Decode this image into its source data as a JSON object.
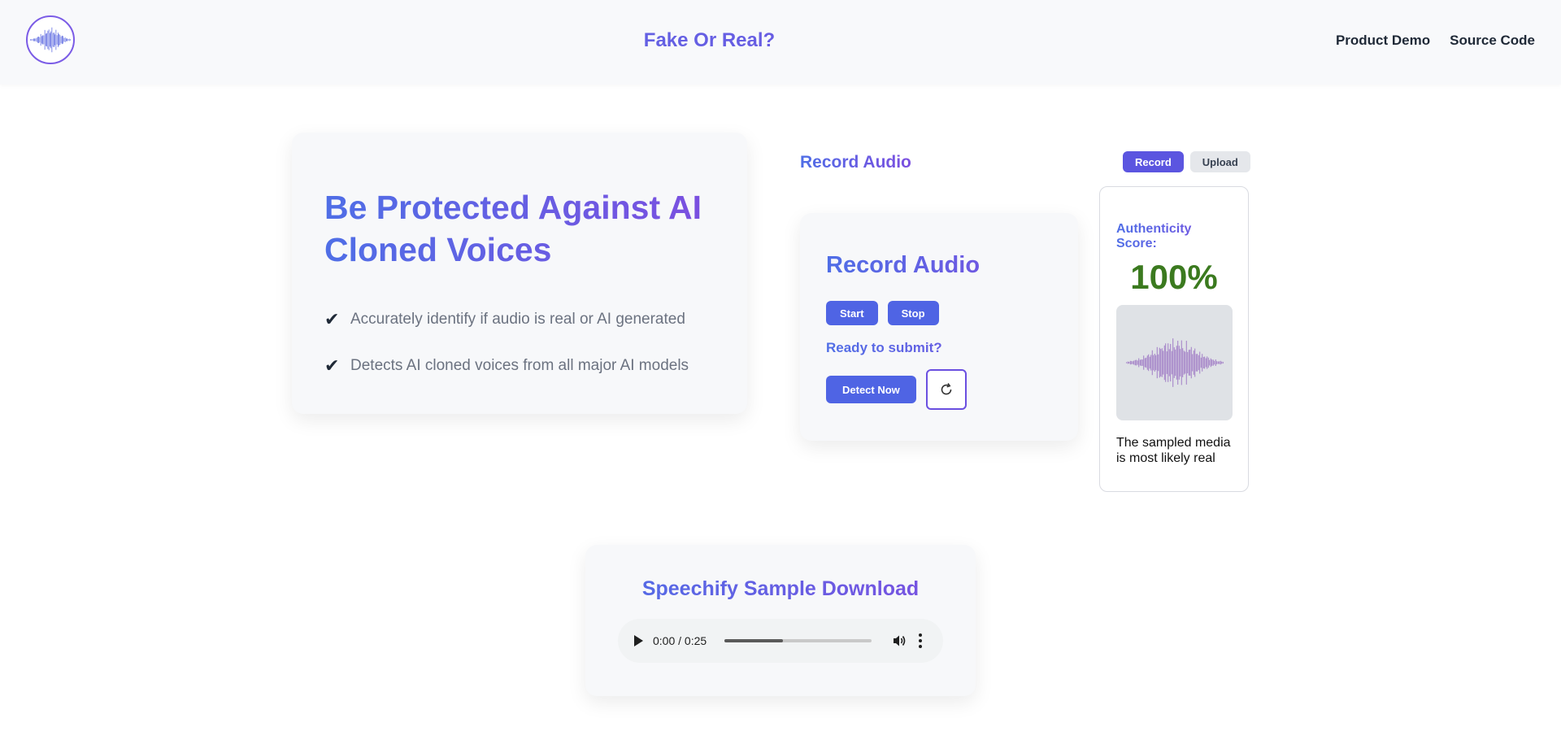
{
  "header": {
    "title": "Fake Or Real?",
    "nav": [
      "Product Demo",
      "Source Code"
    ]
  },
  "hero": {
    "heading": "Be Protected Against AI Cloned Voices",
    "features": [
      "Accurately identify if audio is real or AI generated",
      "Detects AI cloned voices from all major AI models"
    ]
  },
  "record_section": {
    "title": "Record Audio",
    "mode_buttons": [
      "Record",
      "Upload"
    ],
    "active_mode": "Record"
  },
  "record_card": {
    "title": "Record Audio",
    "start_label": "Start",
    "stop_label": "Stop",
    "ready_text": "Ready to submit?",
    "detect_label": "Detect Now"
  },
  "score": {
    "label": "Authenticity Score:",
    "value": "100%",
    "verdict": "The sampled media is most likely real"
  },
  "sample": {
    "title": "Speechify Sample Download",
    "time": "0:00 / 0:25",
    "progress": 0.4
  },
  "colors": {
    "accent": "#5b55e0",
    "button": "#4f64e4",
    "score_green": "#3b7a1f"
  },
  "icons": [
    "logo-waveform-icon",
    "check-icon",
    "refresh-icon",
    "play-icon",
    "volume-icon",
    "more-vert-icon"
  ]
}
